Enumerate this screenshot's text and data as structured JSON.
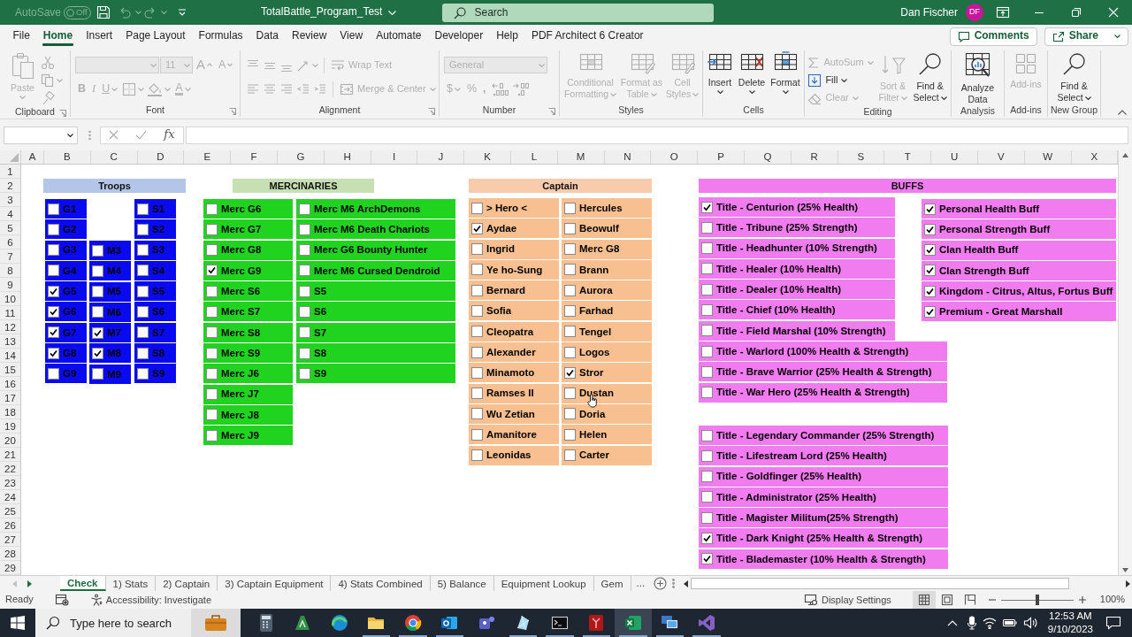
{
  "title_bar": {
    "autosave_label": "AutoSave",
    "autosave_state": "Off",
    "title": "TotalBattle_Program_Test",
    "search": {
      "placeholder": "Search"
    },
    "user_name": "Dan Fischer",
    "user_initials": "DF"
  },
  "menu": {
    "tabs": [
      {
        "label": "File",
        "selected": false
      },
      {
        "label": "Home",
        "selected": true
      },
      {
        "label": "Insert",
        "selected": false
      },
      {
        "label": "Page Layout",
        "selected": false
      },
      {
        "label": "Formulas",
        "selected": false
      },
      {
        "label": "Data",
        "selected": false
      },
      {
        "label": "Review",
        "selected": false
      },
      {
        "label": "View",
        "selected": false
      },
      {
        "label": "Automate",
        "selected": false
      },
      {
        "label": "Developer",
        "selected": false
      },
      {
        "label": "Help",
        "selected": false
      },
      {
        "label": "PDF Architect 6 Creator",
        "selected": false
      }
    ],
    "buttons": [
      {
        "label": "Comments"
      },
      {
        "label": "Share"
      }
    ]
  },
  "ribbon": {
    "groups": [
      {
        "label": "Clipboard",
        "kind": "columns",
        "columns": [
          [
            {
              "kind": "large",
              "label": "Paste",
              "disabled": true
            }
          ],
          [
            {
              "kind": "icon",
              "disabled": true
            },
            {
              "kind": "icon",
              "disabled": true
            },
            {
              "kind": "icon",
              "disabled": true
            }
          ]
        ]
      },
      {
        "label": "Font",
        "kind": "rows",
        "rows": [
          [
            {
              "kind": "field",
              "disabled": true
            },
            {
              "kind": "field",
              "value": "11",
              "disabled": true
            },
            {
              "kind": "glyph",
              "label": "A",
              "disabled": true
            },
            {
              "kind": "glyph",
              "label": "A",
              "disabled": true
            }
          ],
          [
            {
              "kind": "glyph",
              "label": "B",
              "disabled": true
            },
            {
              "kind": "glyph",
              "label": "I",
              "disabled": true
            },
            {
              "kind": "glyph",
              "label": "U",
              "disabled": true
            },
            {
              "kind": "icon",
              "disabled": true
            },
            {
              "kind": "icon",
              "disabled": true
            },
            {
              "kind": "glyph",
              "label": "A",
              "disabled": true
            }
          ]
        ]
      },
      {
        "label": "Alignment",
        "kind": "rows",
        "rows": [
          [
            {
              "kind": "icon",
              "disabled": true
            },
            {
              "kind": "icon",
              "disabled": true
            },
            {
              "kind": "icon",
              "disabled": true
            },
            {
              "kind": "icon",
              "disabled": true
            },
            {
              "kind": "small",
              "label": "Wrap Text",
              "disabled": true
            }
          ],
          [
            {
              "kind": "icon",
              "disabled": true
            },
            {
              "kind": "icon",
              "disabled": true
            },
            {
              "kind": "icon",
              "disabled": true
            },
            {
              "kind": "icon",
              "disabled": true
            },
            {
              "kind": "icon",
              "disabled": true
            },
            {
              "kind": "small",
              "label": "Merge & Center",
              "disabled": true
            }
          ]
        ]
      },
      {
        "label": "Number",
        "kind": "rows",
        "rows": [
          [
            {
              "kind": "field",
              "value": "General",
              "disabled": true
            }
          ],
          [
            {
              "kind": "glyph",
              "label": "$",
              "disabled": true
            },
            {
              "kind": "glyph",
              "label": "%",
              "disabled": true
            },
            {
              "kind": "glyph",
              "label": ",",
              "disabled": true
            },
            {
              "kind": "icon",
              "disabled": true
            },
            {
              "kind": "icon",
              "disabled": true
            }
          ]
        ]
      },
      {
        "label": "Styles",
        "kind": "columns",
        "columns": [
          [
            {
              "kind": "large",
              "label": "Conditional Formatting",
              "disabled": true
            }
          ],
          [
            {
              "kind": "large",
              "label": "Format as Table",
              "disabled": true
            }
          ],
          [
            {
              "kind": "large",
              "label": "Cell Styles",
              "disabled": true
            }
          ]
        ]
      },
      {
        "label": "Cells",
        "kind": "columns",
        "columns": [
          [
            {
              "kind": "large",
              "label": "Insert",
              "disabled": false
            }
          ],
          [
            {
              "kind": "large",
              "label": "Delete",
              "disabled": false
            }
          ],
          [
            {
              "kind": "large",
              "label": "Format",
              "disabled": false
            }
          ]
        ]
      },
      {
        "label": "Editing",
        "kind": "columns",
        "columns": [
          [
            {
              "kind": "small",
              "label": "AutoSum",
              "disabled": true
            },
            {
              "kind": "small",
              "label": "Fill",
              "disabled": false
            },
            {
              "kind": "small",
              "label": "Clear",
              "disabled": true
            }
          ],
          [
            {
              "kind": "large",
              "label": "Sort & Filter",
              "disabled": true
            }
          ],
          [
            {
              "kind": "large",
              "label": "Find & Select",
              "disabled": false
            }
          ]
        ]
      },
      {
        "label": "Analysis",
        "kind": "columns",
        "columns": [
          [
            {
              "kind": "large",
              "label": "Analyze Data",
              "disabled": false
            }
          ]
        ]
      },
      {
        "label": "Add-ins",
        "kind": "columns",
        "columns": [
          [
            {
              "kind": "large",
              "label": "Add-ins",
              "disabled": true
            }
          ]
        ]
      },
      {
        "label": "New Group",
        "kind": "columns",
        "columns": [
          [
            {
              "kind": "large",
              "label": "Find & Select",
              "disabled": false
            }
          ]
        ]
      }
    ]
  },
  "formula_bar": {
    "function_label": "fx"
  },
  "sheet": {
    "column_headers": [
      "A",
      "B",
      "C",
      "D",
      "E",
      "F",
      "G",
      "H",
      "I",
      "J",
      "K",
      "L",
      "M",
      "N",
      "O",
      "P",
      "Q",
      "R",
      "S",
      "T",
      "U",
      "V",
      "W",
      "X"
    ],
    "row_headers": [
      "1",
      "2",
      "3",
      "4",
      "5",
      "6",
      "7",
      "8",
      "9",
      "10",
      "11",
      "12",
      "13",
      "14",
      "15",
      "16",
      "17",
      "18",
      "19",
      "20",
      "21",
      "22",
      "23",
      "24",
      "25",
      "26",
      "27",
      "28",
      "29"
    ],
    "headers": [
      {
        "label": "Troops",
        "color": "#b4c6e7"
      },
      {
        "label": "MERCINARIES",
        "color": "#c6e0b4"
      },
      {
        "label": "Captain",
        "color": "#f8cbad"
      },
      {
        "label": "BUFFS",
        "color": "#f07cf0"
      }
    ],
    "checkbox_columns": [
      {
        "color": "#0a0af0",
        "items": [
          {
            "label": "G1",
            "checked": false
          },
          {
            "label": "G2",
            "checked": false
          },
          {
            "label": "G3",
            "checked": false
          },
          {
            "label": "G4",
            "checked": false
          },
          {
            "label": "G5",
            "checked": true
          },
          {
            "label": "G6",
            "checked": true
          },
          {
            "label": "G7",
            "checked": true
          },
          {
            "label": "G8",
            "checked": true
          },
          {
            "label": "G9",
            "checked": false
          }
        ]
      },
      {
        "color": "#0a0af0",
        "items": [
          {
            "label": "M3",
            "checked": false
          },
          {
            "label": "M4",
            "checked": false
          },
          {
            "label": "M5",
            "checked": false
          },
          {
            "label": "M6",
            "checked": false
          },
          {
            "label": "M7",
            "checked": true
          },
          {
            "label": "M8",
            "checked": true
          },
          {
            "label": "M9",
            "checked": false
          }
        ]
      },
      {
        "color": "#0a0af0",
        "items": [
          {
            "label": "S1",
            "checked": false
          },
          {
            "label": "S2",
            "checked": false
          },
          {
            "label": "S3",
            "checked": false
          },
          {
            "label": "S4",
            "checked": false
          },
          {
            "label": "S5",
            "checked": false
          },
          {
            "label": "S6",
            "checked": false
          },
          {
            "label": "S7",
            "checked": false
          },
          {
            "label": "S8",
            "checked": false
          },
          {
            "label": "S9",
            "checked": false
          }
        ]
      },
      {
        "color": "#1fd31f",
        "items": [
          {
            "label": "Merc G6",
            "checked": false
          },
          {
            "label": "Merc G7",
            "checked": false
          },
          {
            "label": "Merc G8",
            "checked": false
          },
          {
            "label": "Merc G9",
            "checked": true
          },
          {
            "label": "Merc S6",
            "checked": false
          },
          {
            "label": "Merc S7",
            "checked": false
          },
          {
            "label": "Merc S8",
            "checked": false
          },
          {
            "label": "Merc S9",
            "checked": false
          },
          {
            "label": "Merc J6",
            "checked": false
          },
          {
            "label": "Merc J7",
            "checked": false
          },
          {
            "label": "Merc J8",
            "checked": false
          },
          {
            "label": "Merc J9",
            "checked": false
          }
        ]
      },
      {
        "color": "#1fd31f",
        "items": [
          {
            "label": "Merc M6 ArchDemons",
            "checked": false
          },
          {
            "label": "Merc M6 Death Chariots",
            "checked": false
          },
          {
            "label": "Merc G6 Bounty Hunter",
            "checked": false
          },
          {
            "label": "Merc M6 Cursed Dendroid",
            "checked": false
          },
          {
            "label": "S5",
            "checked": false
          },
          {
            "label": "S6",
            "checked": false
          },
          {
            "label": "S7",
            "checked": false
          },
          {
            "label": "S8",
            "checked": false
          },
          {
            "label": "S9",
            "checked": false
          }
        ]
      },
      {
        "color": "#f8c090",
        "items": [
          {
            "label": "> Hero <",
            "checked": false
          },
          {
            "label": "Aydae",
            "checked": true
          },
          {
            "label": "Ingrid",
            "checked": false
          },
          {
            "label": "Ye ho-Sung",
            "checked": false
          },
          {
            "label": "Bernard",
            "checked": false
          },
          {
            "label": "Sofia",
            "checked": false
          },
          {
            "label": "Cleopatra",
            "checked": false
          },
          {
            "label": "Alexander",
            "checked": false
          },
          {
            "label": "Minamoto",
            "checked": false
          },
          {
            "label": "Ramses II",
            "checked": false
          },
          {
            "label": "Wu Zetian",
            "checked": false
          },
          {
            "label": "Amanitore",
            "checked": false
          },
          {
            "label": "Leonidas",
            "checked": false
          }
        ]
      },
      {
        "color": "#f8c090",
        "items": [
          {
            "label": "Hercules",
            "checked": false
          },
          {
            "label": "Beowulf",
            "checked": false
          },
          {
            "label": "Merc G8",
            "checked": false
          },
          {
            "label": "Brann",
            "checked": false
          },
          {
            "label": "Aurora",
            "checked": false
          },
          {
            "label": "Farhad",
            "checked": false
          },
          {
            "label": "Tengel",
            "checked": false
          },
          {
            "label": "Logos",
            "checked": false
          },
          {
            "label": "Stror",
            "checked": true
          },
          {
            "label": "Dustan",
            "checked": false
          },
          {
            "label": "Doria",
            "checked": false
          },
          {
            "label": "Helen",
            "checked": false
          },
          {
            "label": "Carter",
            "checked": false
          }
        ]
      },
      {
        "color": "#f07cf0",
        "items": [
          {
            "label": "Title - Centurion (25% Health)",
            "checked": true
          },
          {
            "label": "Title - Tribune (25% Strength)",
            "checked": false
          },
          {
            "label": "Title - Headhunter (10% Strength)",
            "checked": false
          },
          {
            "label": "Title - Healer (10% Health)",
            "checked": false
          },
          {
            "label": "Title - Dealer (10% Health)",
            "checked": false
          },
          {
            "label": "Title - Chief (10% Health)",
            "checked": false
          },
          {
            "label": "Title - Field Marshal (10% Strength)",
            "checked": false
          },
          {
            "label": "Title - Warlord (100% Health & Strength)",
            "checked": false
          },
          {
            "label": "Title - Brave Warrior (25% Health & Strength)",
            "checked": false
          },
          {
            "label": "Title - War Hero (25% Health & Strength)",
            "checked": false
          }
        ]
      },
      {
        "color": "#f07cf0",
        "items": [
          {
            "label": "Title - Legendary Commander (25% Strength)",
            "checked": false
          },
          {
            "label": "Title - Lifestream Lord (25% Health)",
            "checked": false
          },
          {
            "label": "Title - Goldfinger (25% Health)",
            "checked": false
          },
          {
            "label": "Title - Administrator (25% Health)",
            "checked": false
          },
          {
            "label": "Title - Magister Militum(25% Strength)",
            "checked": false
          },
          {
            "label": "Title - Dark Knight (25% Health & Strength)",
            "checked": true
          },
          {
            "label": "Title - Blademaster (10% Health & Strength)",
            "checked": true
          }
        ]
      },
      {
        "color": "#f07cf0",
        "items": [
          {
            "label": "Personal Health Buff",
            "checked": true
          },
          {
            "label": "Personal Strength Buff",
            "checked": true
          },
          {
            "label": "Clan Health Buff",
            "checked": true
          },
          {
            "label": "Clan Strength Buff",
            "checked": true
          },
          {
            "label": "Kingdom - Citrus, Altus, Fortus Buff",
            "checked": true
          },
          {
            "label": "Premium - Great Marshall",
            "checked": true
          }
        ]
      }
    ]
  },
  "sheet_tabs": {
    "tabs": [
      {
        "label": "Check",
        "selected": true
      },
      {
        "label": "1) Stats",
        "selected": false
      },
      {
        "label": "2) Captain",
        "selected": false
      },
      {
        "label": "3) Captain Equipment",
        "selected": false
      },
      {
        "label": "4) Stats Combined",
        "selected": false
      },
      {
        "label": "5) Balance",
        "selected": false
      },
      {
        "label": "Equipment Lookup",
        "selected": false
      },
      {
        "label": "Gem",
        "selected": false
      }
    ],
    "overflow": "..."
  },
  "status_bar": {
    "status": "Ready",
    "accessibility": "Accessibility: Investigate",
    "display_settings": "Display Settings",
    "views": [
      {
        "selected": true
      },
      {
        "selected": false
      },
      {
        "selected": false
      }
    ],
    "zoom": {
      "level": 0.5,
      "reading": "100%"
    }
  },
  "taskbar": {
    "search": {
      "placeholder": "Type here to search"
    },
    "apps": [
      {
        "running": false,
        "selected": false
      },
      {
        "running": false,
        "selected": false
      },
      {
        "running": false,
        "selected": false
      },
      {
        "running": true,
        "selected": false
      },
      {
        "running": true,
        "selected": false
      },
      {
        "running": true,
        "selected": false
      },
      {
        "running": false,
        "selected": false
      },
      {
        "running": true,
        "selected": false
      },
      {
        "running": true,
        "selected": false
      },
      {
        "running": true,
        "selected": false
      },
      {
        "running": true,
        "selected": true
      },
      {
        "running": true,
        "selected": false
      },
      {
        "running": true,
        "selected": false
      }
    ],
    "time": "12:53 AM",
    "date": "9/10/2023"
  }
}
